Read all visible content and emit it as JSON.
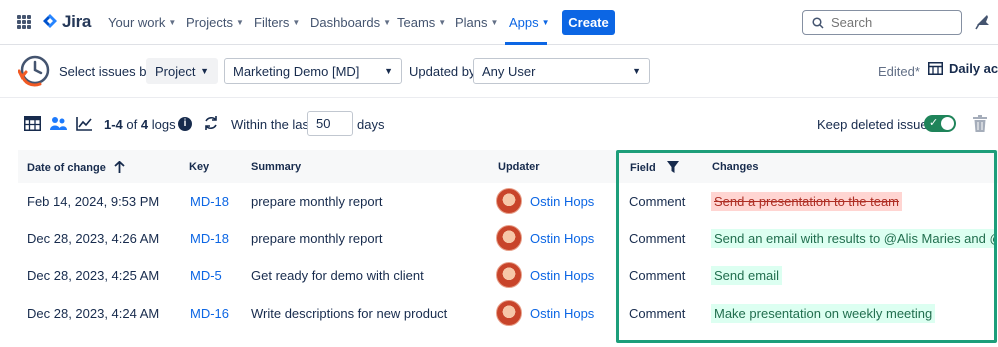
{
  "nav": {
    "logo": "Jira",
    "items": [
      "Your work",
      "Projects",
      "Filters",
      "Dashboards",
      "Teams",
      "Plans",
      "Apps"
    ],
    "create": "Create",
    "search_placeholder": "Search"
  },
  "filters": {
    "select_by_label": "Select issues by:",
    "select_by_value": "Project",
    "project_value": "Marketing Demo [MD]",
    "updated_by_label": "Updated by:",
    "updated_by_value": "Any User",
    "edited": "Edited*",
    "view_name": "Daily acti"
  },
  "toolbar": {
    "count_range": "1-4",
    "count_of": "of",
    "count_total": "4",
    "count_unit": "logs",
    "within_label": "Within the last:",
    "within_value": "50",
    "days_label": "days",
    "keep_label": "Keep deleted issues",
    "keep_on": true
  },
  "table": {
    "headers": {
      "date": "Date of change",
      "key": "Key",
      "summary": "Summary",
      "updater": "Updater",
      "field": "Field",
      "changes": "Changes"
    },
    "rows": [
      {
        "date": "Feb 14, 2024, 9:53 PM",
        "key": "MD-18",
        "summary": "prepare monthly report",
        "updater": "Ostin Hops",
        "field": "Comment",
        "change": "Send a presentation to the team",
        "change_type": "deleted"
      },
      {
        "date": "Dec 28, 2023, 4:26 AM",
        "key": "MD-18",
        "summary": "prepare monthly report",
        "updater": "Ostin Hops",
        "field": "Comment",
        "change": "Send an email with results to @Alis Maries and @Dor...",
        "change_type": "added"
      },
      {
        "date": "Dec 28, 2023, 4:25 AM",
        "key": "MD-5",
        "summary": "Get ready for demo with client",
        "updater": "Ostin Hops",
        "field": "Comment",
        "change": "Send email",
        "change_type": "added"
      },
      {
        "date": "Dec 28, 2023, 4:24 AM",
        "key": "MD-16",
        "summary": "Write descriptions for new product",
        "updater": "Ostin Hops",
        "field": "Comment",
        "change": "Make presentation on weekly meeting",
        "change_type": "added"
      }
    ]
  },
  "colors": {
    "brand": "#0c66e4",
    "highlight": "#1d9e7a",
    "deleted_bg": "#ffd5d2",
    "added_bg": "#dcfff1"
  }
}
